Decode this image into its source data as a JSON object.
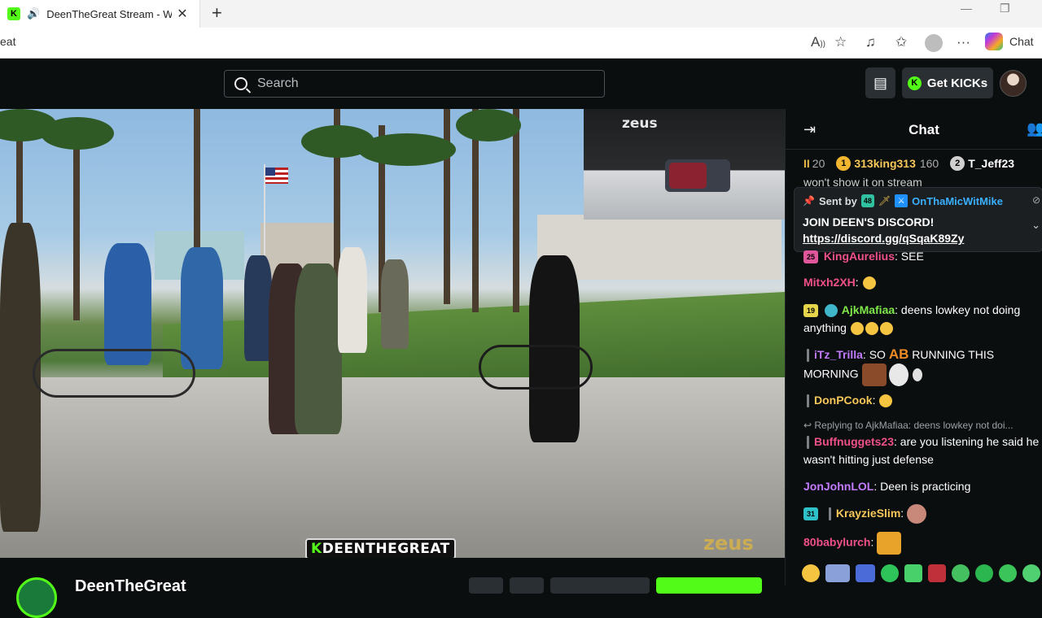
{
  "browser": {
    "tab_title": "DeenTheGreat Stream - Watch",
    "tab_close": "✕",
    "new_tab": "+",
    "address": "eat",
    "chat_label": "Chat",
    "favicon_letter": "K"
  },
  "header": {
    "search_placeholder": "Search",
    "get_kicks_label": "Get KICKs",
    "kick_letter": "K"
  },
  "video": {
    "pip_logo": "zeus",
    "watermark": "zeus",
    "channel_overlay_k": "K",
    "channel_overlay_name": "DEENTHEGREAT"
  },
  "channel": {
    "name": "DeenTheGreat"
  },
  "chat": {
    "title": "Chat",
    "leaderboard": {
      "pause_icon": "II",
      "pause_count": "20",
      "first_rank": "1",
      "first_name": "313king313",
      "first_count": "160",
      "second_rank": "2",
      "second_name": "T_Jeff23"
    },
    "behind_text": "won't show it on stream",
    "pinned": {
      "sent_by": "Sent by",
      "sub_months": "48",
      "author": "OnThaMicWitMike",
      "line1": "JOIN DEEN'S DISCORD!",
      "line2": "https://discord.gg/qSqaK89Zy"
    },
    "messages": [
      {
        "badge": "25",
        "user": "KingAurelius",
        "text": ": SEE"
      },
      {
        "user": "Mitxh2XH",
        "text": ":"
      },
      {
        "badge": "19",
        "user": "AjkMafiaa",
        "text": ": deens lowkey not doing anything"
      },
      {
        "user": "iTz_Trilla",
        "text": ": SO",
        "text_ab": "AB",
        "text2": " RUNNING THIS MORNING"
      },
      {
        "user": "DonPCook",
        "text": ":"
      },
      {
        "reply": "Replying to AjkMafiaa: deens lowkey not doi...",
        "user": "Buffnuggets23",
        "text": ": are you listening he said he wasn't hitting just defense"
      },
      {
        "user": "JonJohnLOL",
        "text": ": Deen is practicing"
      },
      {
        "badge": "31",
        "user": "KrayzieSlim",
        "text": ":"
      },
      {
        "user": "80babylurch",
        "text": ":"
      }
    ]
  },
  "colors": {
    "kick_green": "#53fc18",
    "pink_user": "#f0508a",
    "violet_user": "#c27bff",
    "green_user": "#7ee84a",
    "gold_user": "#f7c75a"
  }
}
